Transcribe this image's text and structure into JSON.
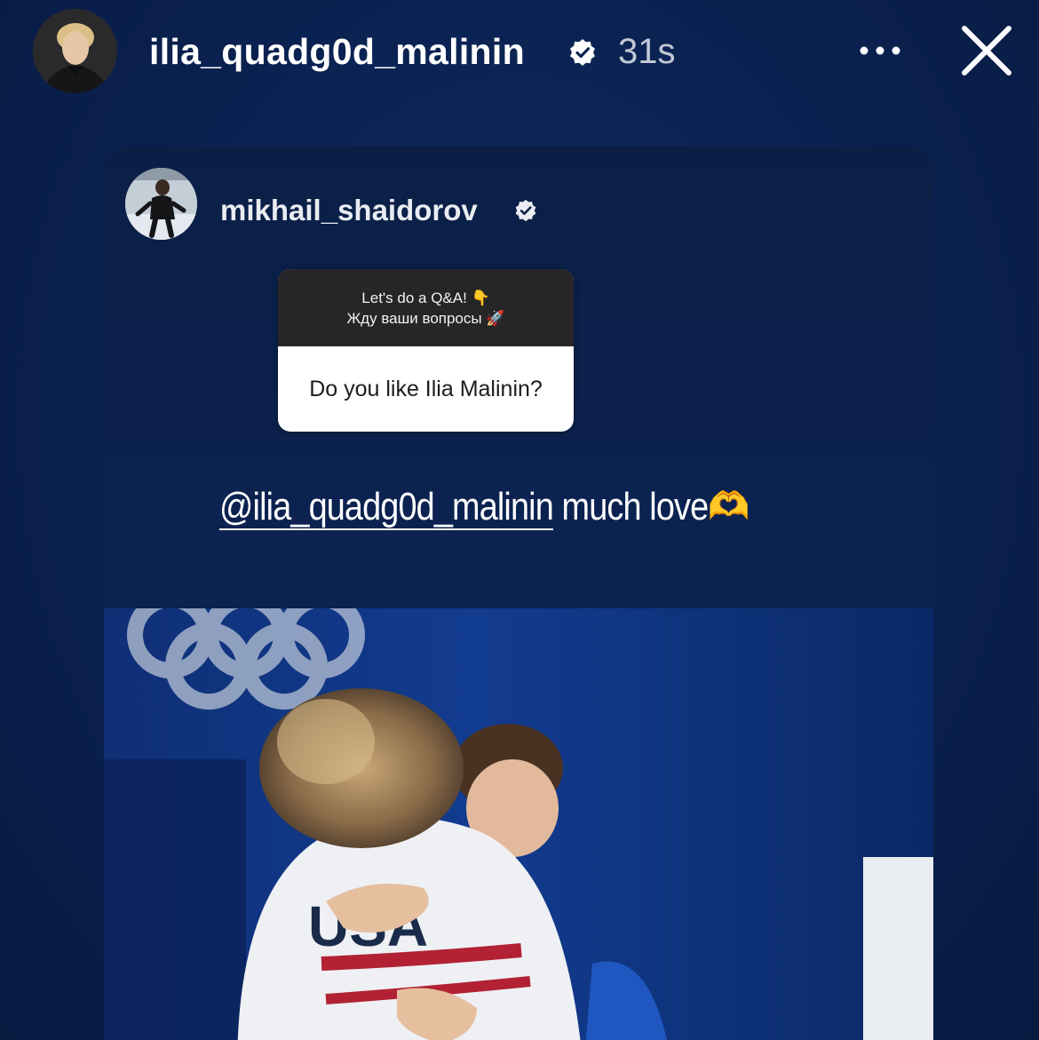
{
  "header": {
    "username": "ilia_quadg0d_malinin",
    "time_ago": "31s",
    "more_label": "•••"
  },
  "shared_post": {
    "username": "mikhail_shaidorov",
    "question_box": {
      "prompt_line1": "Let's do a Q&A! 👇",
      "prompt_line2": "Жду ваши вопросы 🚀",
      "question": "Do you like Ilia Malinin?"
    },
    "reply": {
      "mention": "@ilia_quadg0d_malinin",
      "text": " much love🫶"
    },
    "photo": {
      "jacket_text": "USA"
    }
  },
  "colors": {
    "background": "#0a2150",
    "qa_header": "#262628",
    "text": "#ffffff"
  }
}
